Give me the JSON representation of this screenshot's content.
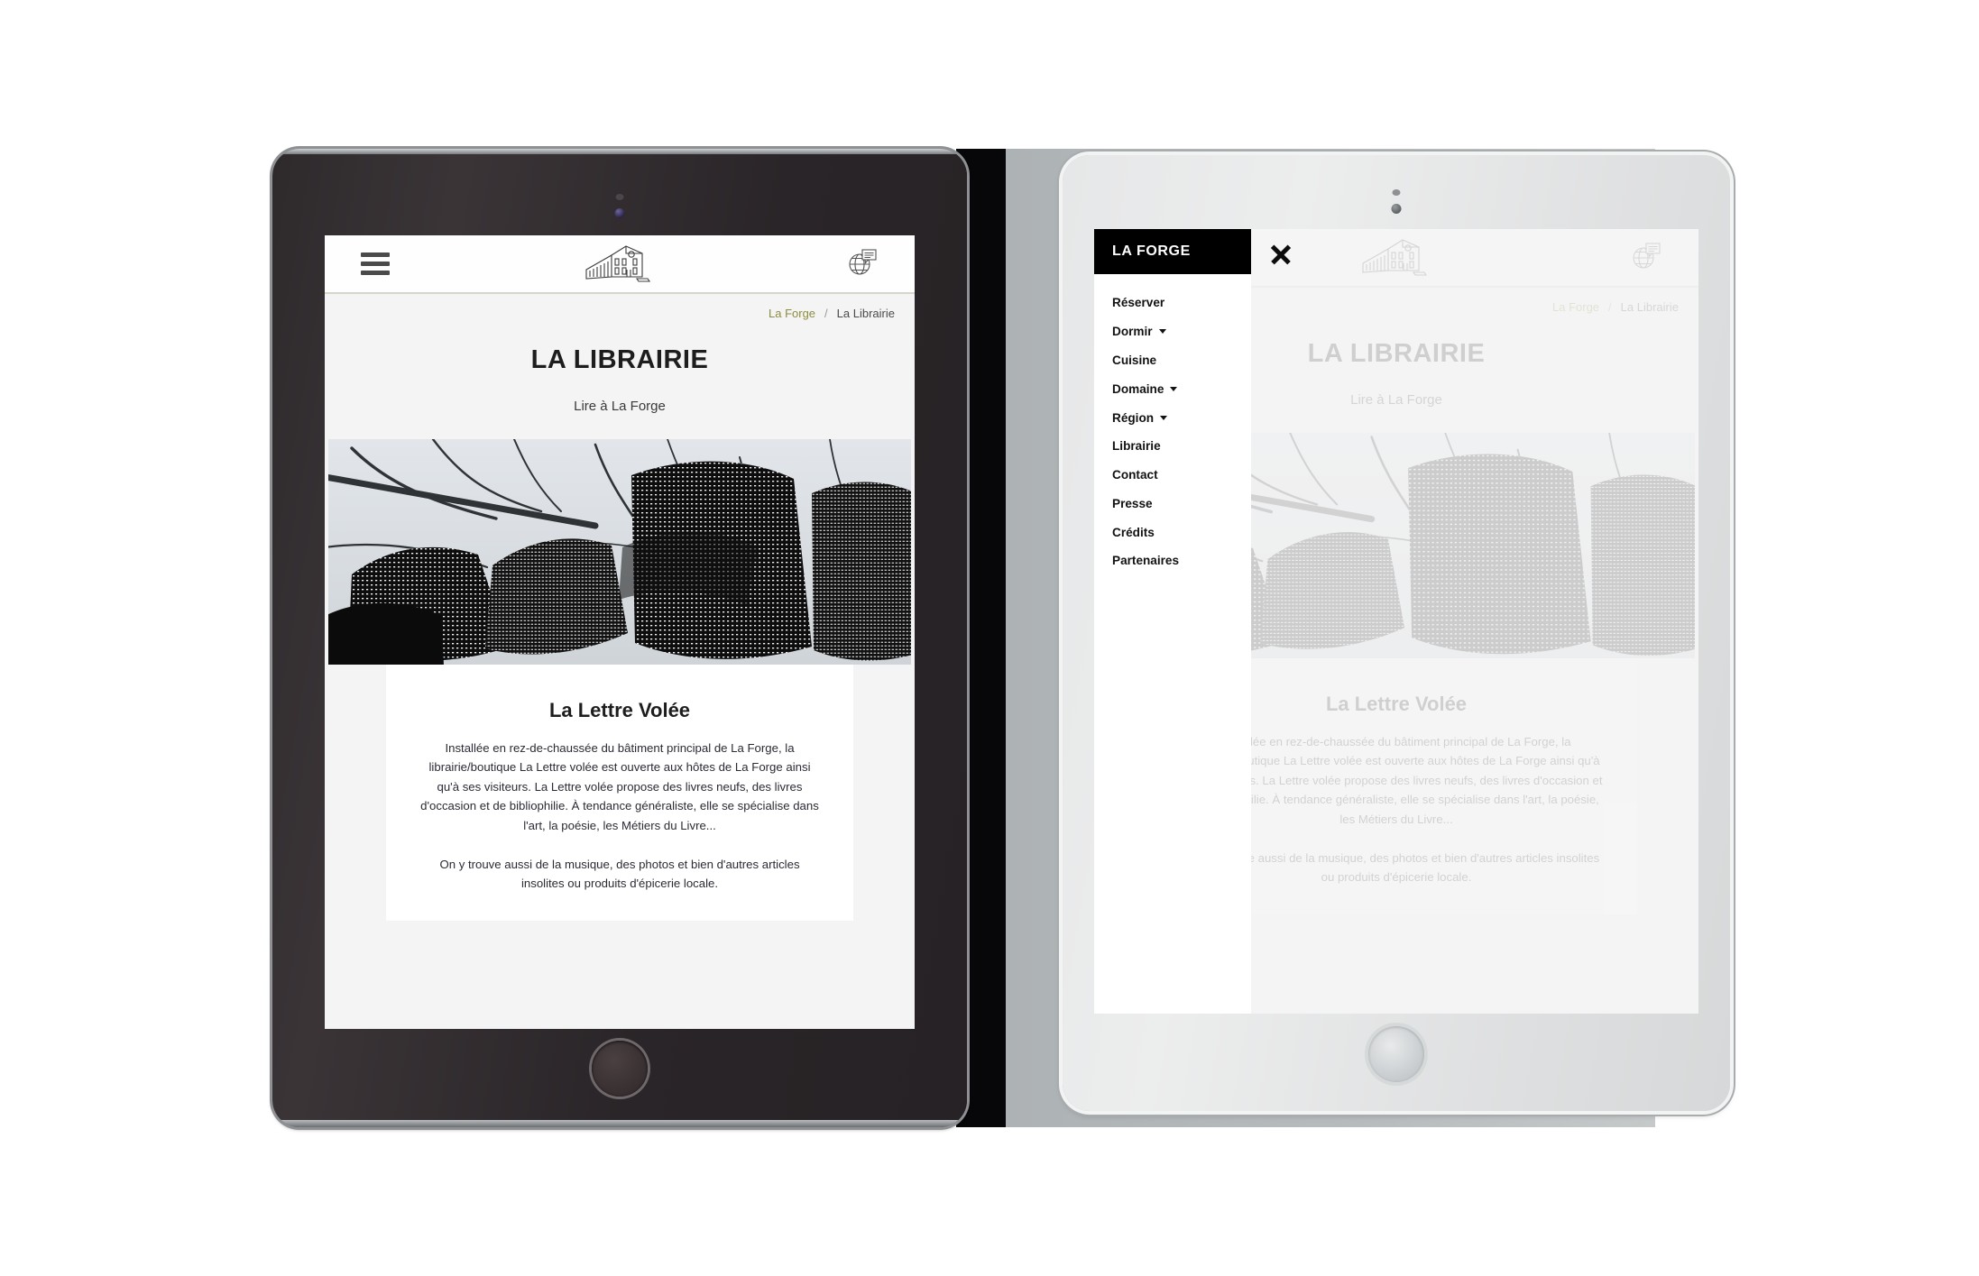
{
  "site": {
    "logo_alt": "La Forge building logo",
    "breadcrumb": {
      "home": "La Forge",
      "separator": "/",
      "current": "La Librairie"
    },
    "page_title": "LA LIBRAIRIE",
    "page_subtitle": "Lire à La Forge",
    "article": {
      "heading": "La Lettre Volée",
      "paragraph1": "Installée en rez-de-chaussée du bâtiment principal de La Forge, la librairie/boutique La Lettre volée est ouverte aux hôtes de La Forge ainsi qu'à ses visiteurs. La Lettre volée propose des livres neufs, des livres d'occasion et de bibliophilie. À tendance généraliste, elle se spécialise dans l'art, la poésie, les Métiers du Livre...",
      "paragraph2": "On y trouve aussi de la musique, des photos et bien d'autres articles insolites ou produits d'épicerie locale."
    },
    "icons": {
      "menu": "hamburger-menu-icon",
      "language": "globe-language-icon",
      "close": "close-icon"
    },
    "colors": {
      "accent_olive": "#8d8c3f",
      "menu_header_bg": "#000000",
      "page_bg": "#f4f4f4",
      "card_bg": "#ffffff",
      "border": "#d8d5c9"
    }
  },
  "menu": {
    "title": "LA FORGE",
    "items": [
      {
        "label": "Réserver",
        "has_submenu": false
      },
      {
        "label": "Dormir",
        "has_submenu": true
      },
      {
        "label": "Cuisine",
        "has_submenu": false
      },
      {
        "label": "Domaine",
        "has_submenu": true
      },
      {
        "label": "Région",
        "has_submenu": true
      },
      {
        "label": "Librairie",
        "has_submenu": false
      },
      {
        "label": "Contact",
        "has_submenu": false
      },
      {
        "label": "Presse",
        "has_submenu": false
      },
      {
        "label": "Crédits",
        "has_submenu": false
      },
      {
        "label": "Partenaires",
        "has_submenu": false
      }
    ]
  },
  "devices": {
    "left": {
      "name": "tablet-dark",
      "state": "menu-closed"
    },
    "right": {
      "name": "tablet-white",
      "state": "menu-open"
    }
  }
}
